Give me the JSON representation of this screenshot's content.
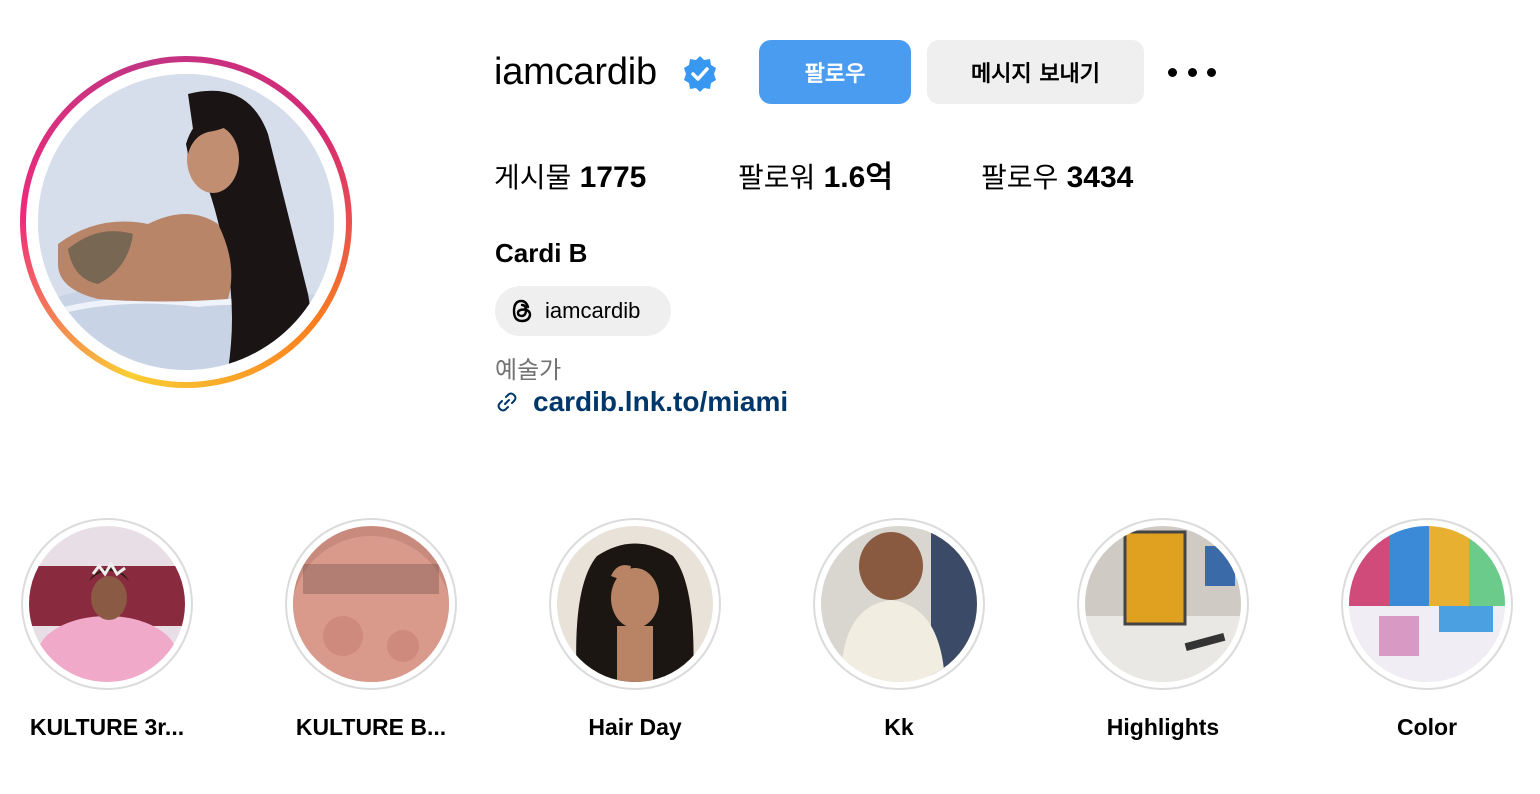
{
  "profile": {
    "username": "iamcardib",
    "verified_icon": "verified-badge-icon",
    "follow_label": "팔로우",
    "message_label": "메시지 보내기",
    "more_icon": "more-options-icon",
    "accent_color": "#4a9cf0",
    "link_color": "#00376b"
  },
  "stats": {
    "posts_label": "게시물",
    "posts_value": "1775",
    "followers_label": "팔로워",
    "followers_value": "1.6억",
    "following_label": "팔로우",
    "following_value": "3434"
  },
  "bio": {
    "full_name": "Cardi B",
    "threads_handle": "iamcardib",
    "threads_icon": "threads-icon",
    "category": "예술가",
    "link_icon": "link-icon",
    "link": "cardib.lnk.to/miami"
  },
  "highlights": [
    {
      "label": "KULTURE 3r..."
    },
    {
      "label": "KULTURE B..."
    },
    {
      "label": "Hair Day"
    },
    {
      "label": "Kk"
    },
    {
      "label": "Highlights"
    },
    {
      "label": "Color"
    }
  ]
}
